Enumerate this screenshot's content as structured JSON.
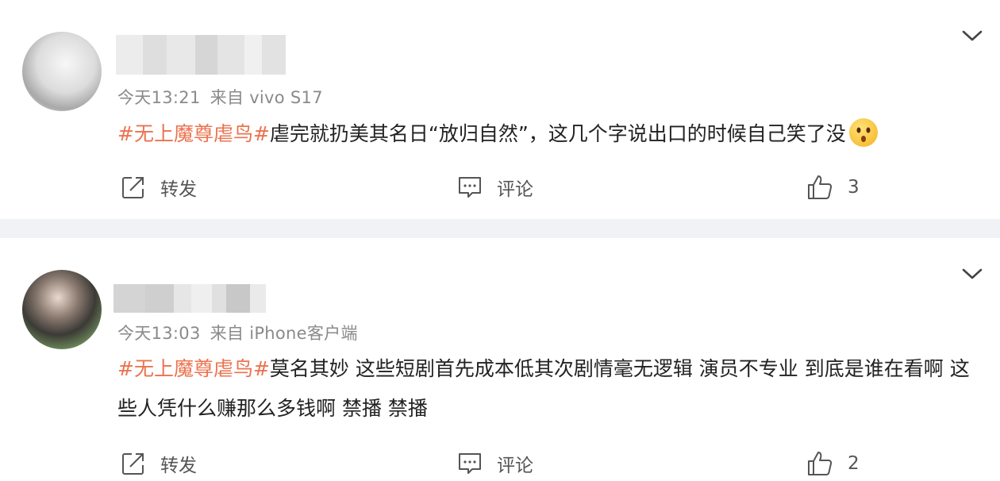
{
  "posts": [
    {
      "timestamp": "今天13:21",
      "source": "来自 vivo S17",
      "hashtag": "#无上魔尊虐鸟#",
      "text": "虐完就扔美其名日“放归自然”，这几个字说出口的时候自己笑了没",
      "emoji": "😲",
      "actions": {
        "forward": "转发",
        "comment": "评论",
        "like_count": "3"
      },
      "avatar_icon": "avatar-icon"
    },
    {
      "timestamp": "今天13:03",
      "source": "来自 iPhone客户端",
      "hashtag": "#无上魔尊虐鸟#",
      "text": "莫名其妙 这些短剧首先成本低其次剧情毫无逻辑 演员不专业 到底是谁在看啊 这些人凭什么赚那么多钱啊 禁播 禁播",
      "actions": {
        "forward": "转发",
        "comment": "评论",
        "like_count": "2"
      },
      "avatar_icon": "avatar-icon"
    }
  ],
  "colors": {
    "hashtag": "#eb7350",
    "meta": "#8a8a8a",
    "divider": "#f1f2f5"
  }
}
